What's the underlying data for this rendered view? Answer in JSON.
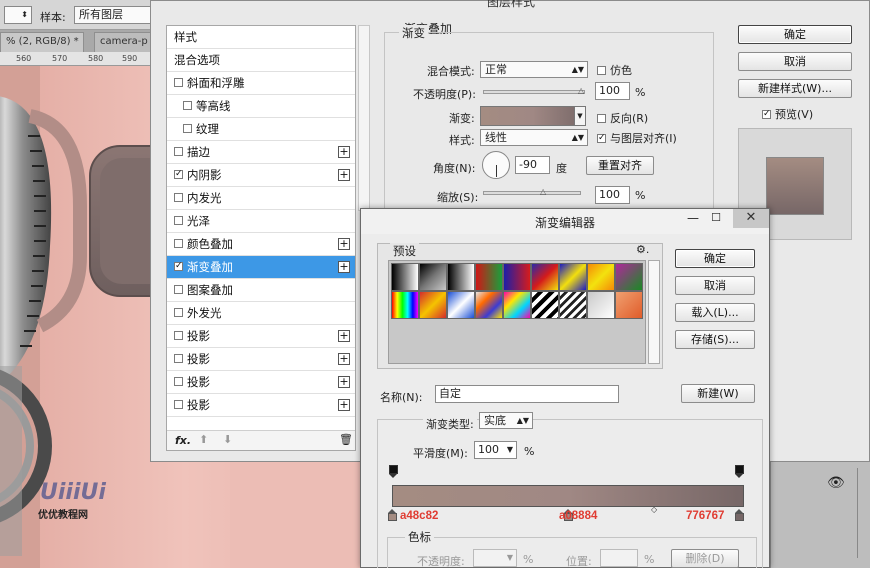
{
  "photoshop": {
    "sample_label": "样本:",
    "sample_value": "所有图层",
    "tabs": [
      "% (2, RGB/8) *",
      "camera-p"
    ],
    "ruler_ticks": [
      "560",
      "570",
      "580",
      "590"
    ],
    "watermark_site": "优优教程网",
    "watermark_logo": "UiiiUi"
  },
  "layer_style": {
    "title": "图层样式",
    "list_items": [
      {
        "label": "样式",
        "checkbox": false,
        "indent": 0,
        "plus": false,
        "checked": false,
        "selected": false
      },
      {
        "label": "混合选项",
        "checkbox": false,
        "indent": 0,
        "plus": false,
        "checked": false,
        "selected": false
      },
      {
        "label": "斜面和浮雕",
        "checkbox": true,
        "indent": 0,
        "plus": false,
        "checked": false,
        "selected": false
      },
      {
        "label": "等高线",
        "checkbox": true,
        "indent": 1,
        "plus": false,
        "checked": false,
        "selected": false
      },
      {
        "label": "纹理",
        "checkbox": true,
        "indent": 1,
        "plus": false,
        "checked": false,
        "selected": false
      },
      {
        "label": "描边",
        "checkbox": true,
        "indent": 0,
        "plus": true,
        "checked": false,
        "selected": false
      },
      {
        "label": "内阴影",
        "checkbox": true,
        "indent": 0,
        "plus": true,
        "checked": true,
        "selected": false
      },
      {
        "label": "内发光",
        "checkbox": true,
        "indent": 0,
        "plus": false,
        "checked": false,
        "selected": false
      },
      {
        "label": "光泽",
        "checkbox": true,
        "indent": 0,
        "plus": false,
        "checked": false,
        "selected": false
      },
      {
        "label": "颜色叠加",
        "checkbox": true,
        "indent": 0,
        "plus": true,
        "checked": false,
        "selected": false
      },
      {
        "label": "渐变叠加",
        "checkbox": true,
        "indent": 0,
        "plus": true,
        "checked": true,
        "selected": true
      },
      {
        "label": "图案叠加",
        "checkbox": true,
        "indent": 0,
        "plus": false,
        "checked": false,
        "selected": false
      },
      {
        "label": "外发光",
        "checkbox": true,
        "indent": 0,
        "plus": false,
        "checked": false,
        "selected": false
      },
      {
        "label": "投影",
        "checkbox": true,
        "indent": 0,
        "plus": true,
        "checked": false,
        "selected": false
      },
      {
        "label": "投影",
        "checkbox": true,
        "indent": 0,
        "plus": true,
        "checked": false,
        "selected": false
      },
      {
        "label": "投影",
        "checkbox": true,
        "indent": 0,
        "plus": true,
        "checked": false,
        "selected": false
      },
      {
        "label": "投影",
        "checkbox": true,
        "indent": 0,
        "plus": true,
        "checked": false,
        "selected": false
      }
    ],
    "footer_fx": "fx.",
    "section_title": "渐变叠加",
    "group_title": "渐变",
    "blend_mode_label": "混合模式:",
    "blend_mode_value": "正常",
    "dither_label": "仿色",
    "opacity_label": "不透明度(P):",
    "opacity_value": "100",
    "opacity_unit": "%",
    "gradient_label": "渐变:",
    "reverse_label": "反向(R)",
    "style_label": "样式:",
    "style_value": "线性",
    "align_label": "与图层对齐(I)",
    "angle_label": "角度(N):",
    "angle_value": "-90",
    "angle_unit": "度",
    "reset_align_label": "重置对齐",
    "scale_label": "缩放(S):",
    "scale_value": "100",
    "scale_unit": "%",
    "ok_label": "确定",
    "cancel_label": "取消",
    "new_style_label": "新建样式(W)...",
    "preview_label": "预览(V)"
  },
  "gradient_editor": {
    "title": "渐变编辑器",
    "presets_label": "预设",
    "ok_label": "确定",
    "cancel_label": "取消",
    "load_label": "载入(L)...",
    "save_label": "存储(S)...",
    "name_label": "名称(N):",
    "name_value": "自定",
    "new_label": "新建(W)",
    "gradient_type_label": "渐变类型:",
    "gradient_type_value": "实底",
    "smoothness_label": "平滑度(M):",
    "smoothness_value": "100",
    "smoothness_unit": "%",
    "color_stops_label": "色标",
    "stop_opacity_label": "不透明度:",
    "stop_opacity_unit": "%",
    "location_label": "位置:",
    "location_unit": "%",
    "delete_label": "删除(D)",
    "color_stops": [
      {
        "hex": "a48c82",
        "color": "#a48c82",
        "location": 0
      },
      {
        "hex": "a08884",
        "color": "#a08884",
        "location": 50
      },
      {
        "hex": "776767",
        "color": "#776767",
        "location": 100
      }
    ],
    "preset_swatches": [
      "linear-gradient(90deg,#000,#fff)",
      "linear-gradient(135deg,#000 0%,#777 50%,rgba(0,0,0,0) 100%)",
      "linear-gradient(90deg,#000,#fff)",
      "linear-gradient(90deg,#d01616,#18a03c)",
      "linear-gradient(90deg,#1d1da8,#d61c1c)",
      "linear-gradient(135deg,#2a2aa8,#d41b1b,#f1e20e)",
      "linear-gradient(135deg,#1c1cc2,#f3df0d,#1c1cc2)",
      "linear-gradient(135deg,#f58a07,#f3e20e,#f58a07)",
      "linear-gradient(135deg,#b0279b,#1a8a24)",
      "linear-gradient(90deg,#ff0000,#ffff00,#00ff00,#00ffff,#0000ff,#ff00ff)",
      "linear-gradient(135deg,#d32d2d,#f5c400,#d32d2d)",
      "linear-gradient(135deg,#1a4fd6,#fff,#1a4fd6)",
      "linear-gradient(135deg,#e5e5e5,#ff6a00,#3b3bd4,#ffe600)",
      "linear-gradient(135deg,#ff00aa,#ffe600,#00d4ff,#ff00aa)",
      "repeating-linear-gradient(135deg,#ffffff 0 4px,#000 4px 8px)",
      "repeating-linear-gradient(135deg,#ffffff 0 3px,#222 3px 6px)",
      "linear-gradient(135deg,#c9c9c9,#ffffff)",
      "linear-gradient(135deg,#f0a070,#e05c2a)"
    ]
  }
}
